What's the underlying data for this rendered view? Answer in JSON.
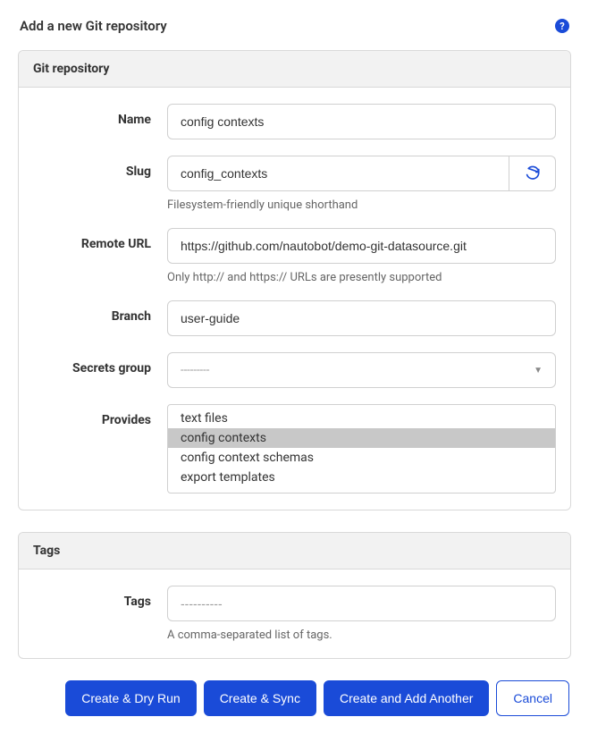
{
  "page": {
    "title": "Add a new Git repository"
  },
  "panel1": {
    "title": "Git repository"
  },
  "form": {
    "name": {
      "label": "Name",
      "value": "config contexts"
    },
    "slug": {
      "label": "Slug",
      "value": "config_contexts",
      "help": "Filesystem-friendly unique shorthand"
    },
    "remote_url": {
      "label": "Remote URL",
      "value": "https://github.com/nautobot/demo-git-datasource.git",
      "help": "Only http:// and https:// URLs are presently supported"
    },
    "branch": {
      "label": "Branch",
      "value": "user-guide"
    },
    "secrets_group": {
      "label": "Secrets group",
      "placeholder": "---------"
    },
    "provides": {
      "label": "Provides",
      "options": [
        "text files",
        "config contexts",
        "config context schemas",
        "export templates"
      ],
      "selected": "config contexts"
    }
  },
  "panel2": {
    "title": "Tags",
    "tags": {
      "label": "Tags",
      "placeholder": "----------",
      "help": "A comma-separated list of tags."
    }
  },
  "buttons": {
    "create_dry": "Create & Dry Run",
    "create_sync": "Create & Sync",
    "create_another": "Create and Add Another",
    "cancel": "Cancel"
  }
}
